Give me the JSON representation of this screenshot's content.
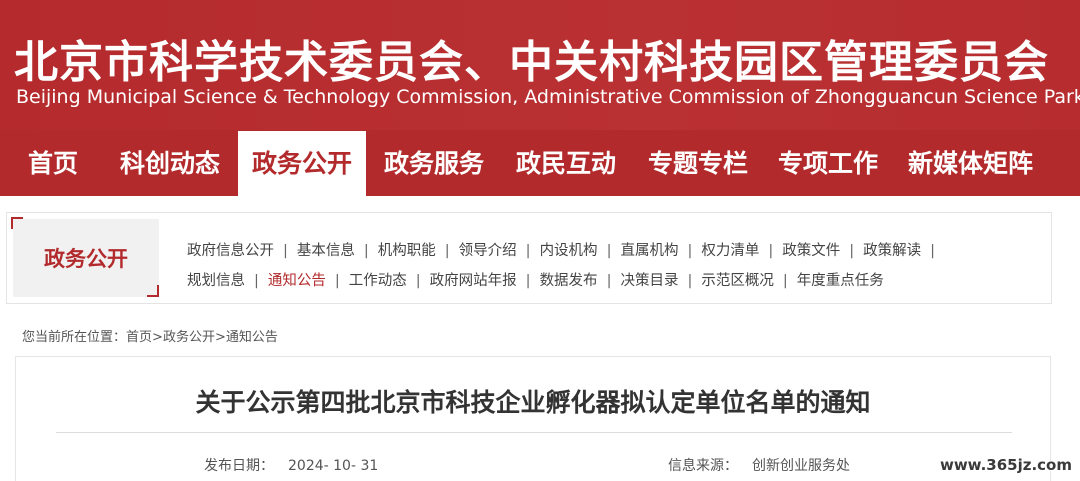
{
  "header": {
    "title_cn": "北京市科学技术委员会、中关村科技园区管理委员会",
    "title_en": "Beijing Municipal Science & Technology Commission, Administrative Commission of Zhongguancun Science Park"
  },
  "nav": {
    "items": [
      {
        "label": "首页"
      },
      {
        "label": "科创动态"
      },
      {
        "label": "政务公开",
        "active": true
      },
      {
        "label": "政务服务"
      },
      {
        "label": "政民互动"
      },
      {
        "label": "专题专栏"
      },
      {
        "label": "专项工作"
      },
      {
        "label": "新媒体矩阵"
      }
    ]
  },
  "subnav": {
    "label": "政务公开",
    "row1": [
      "政府信息公开",
      "基本信息",
      "机构职能",
      "领导介绍",
      "内设机构",
      "直属机构",
      "权力清单",
      "政策文件",
      "政策解读"
    ],
    "row2": [
      "规划信息",
      "通知公告",
      "工作动态",
      "政府网站年报",
      "数据发布",
      "决策目录",
      "示范区概况",
      "年度重点任务"
    ],
    "separator": "|"
  },
  "breadcrumb": {
    "prefix": "您当前所在位置：",
    "items": [
      "首页",
      "政务公开",
      "通知公告"
    ],
    "separator": ">"
  },
  "article": {
    "title": "关于公示第四批北京市科技企业孵化器拟认定单位名单的通知",
    "date_label": "发布日期：",
    "date_value": "2024- 10- 31",
    "source_label": "信息来源：",
    "source_value": "创新创业服务处"
  },
  "watermark": "www.365jz.com",
  "colors": {
    "brand_red": "#b32a2c",
    "text": "#333333"
  }
}
